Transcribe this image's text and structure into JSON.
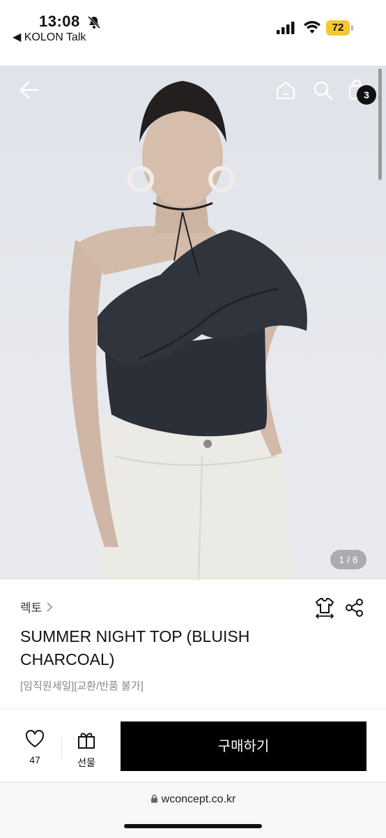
{
  "status_bar": {
    "time": "13:08",
    "back_app": "◀ KOLON Talk",
    "battery": "72"
  },
  "nav": {
    "cart_count": "3"
  },
  "hero": {
    "image_counter": "1 / 6"
  },
  "product": {
    "brand": "렉토",
    "title": "SUMMER NIGHT TOP (BLUISH CHARCOAL)",
    "subtitle": "[임직원세일][교환/반품 불가]"
  },
  "actions": {
    "like_count": "47",
    "gift_label": "선물",
    "buy_label": "구매하기"
  },
  "browser": {
    "url": "wconcept.co.kr"
  },
  "colors": {
    "accent": "#000000",
    "badge": "#111111",
    "battery": "#f6c82f"
  }
}
